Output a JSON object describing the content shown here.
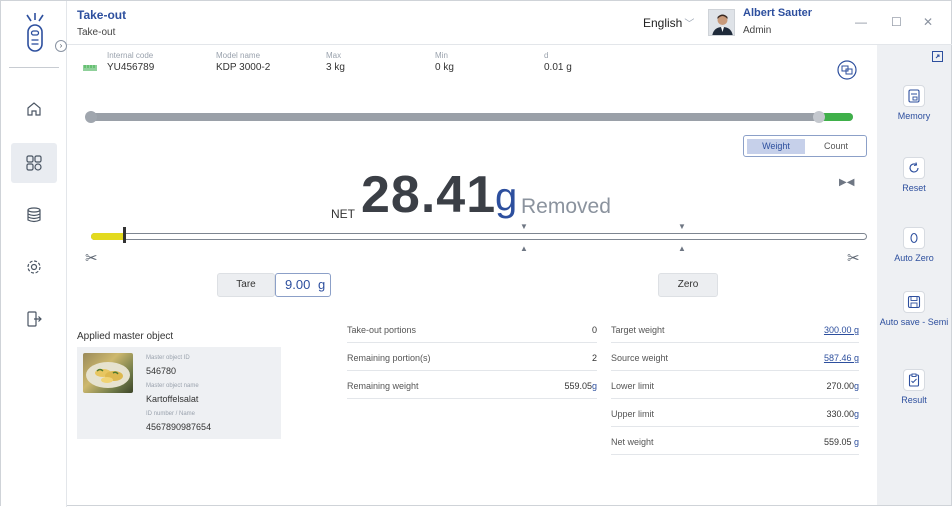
{
  "header": {
    "title": "Take-out",
    "subtitle": "Take-out",
    "language": "English",
    "user_name": "Albert Sauter",
    "user_role": "Admin",
    "collapse": "›"
  },
  "window": {
    "minimize": "—",
    "maximize": "☐",
    "close": "✕"
  },
  "info": [
    {
      "label": "Internal code",
      "value": "YU456789"
    },
    {
      "label": "Model name",
      "value": "KDP 3000-2"
    },
    {
      "label": "Max",
      "value": "3 kg"
    },
    {
      "label": "Min",
      "value": "0 kg"
    },
    {
      "label": "d",
      "value": "0.01 g"
    }
  ],
  "mode": {
    "weight": "Weight",
    "count": "Count"
  },
  "reading": {
    "prefix": "NET",
    "value": "28.41",
    "unit": "g",
    "status": "Removed"
  },
  "controls": {
    "tare_label": "Tare",
    "tare_value": "9.00",
    "tare_unit": "g",
    "zero_label": "Zero"
  },
  "master_object": {
    "title": "Applied master object",
    "id_label": "Master object ID",
    "id": "546780",
    "name_label": "Master object name",
    "name": "Kartoffelsalat",
    "idnum_label": "ID number / Name",
    "idnum": "4567890987654"
  },
  "portions": [
    {
      "label": "Take-out portions",
      "value": "0"
    },
    {
      "label": "Remaining portion(s)",
      "value": "2"
    },
    {
      "label": "Remaining weight",
      "value": "559.05",
      "unit": "g"
    }
  ],
  "targets": [
    {
      "label": "Target weight",
      "value": "300.00 g"
    },
    {
      "label": "Source weight",
      "value": "587.46 g"
    },
    {
      "label": "Lower limit",
      "value": "270.00",
      "unit": "g"
    },
    {
      "label": "Upper limit",
      "value": "330.00",
      "unit": "g"
    },
    {
      "label": "Net weight",
      "value": "559.05",
      "unit": "g"
    }
  ],
  "actions": {
    "memory": "Memory",
    "reset": "Reset",
    "auto_zero": "Auto Zero",
    "auto_save": "Auto save - Semi",
    "result": "Result"
  },
  "colors": {
    "accent": "#2d4f9e",
    "green": "#3fb04a",
    "yellow": "#e3da1e"
  }
}
